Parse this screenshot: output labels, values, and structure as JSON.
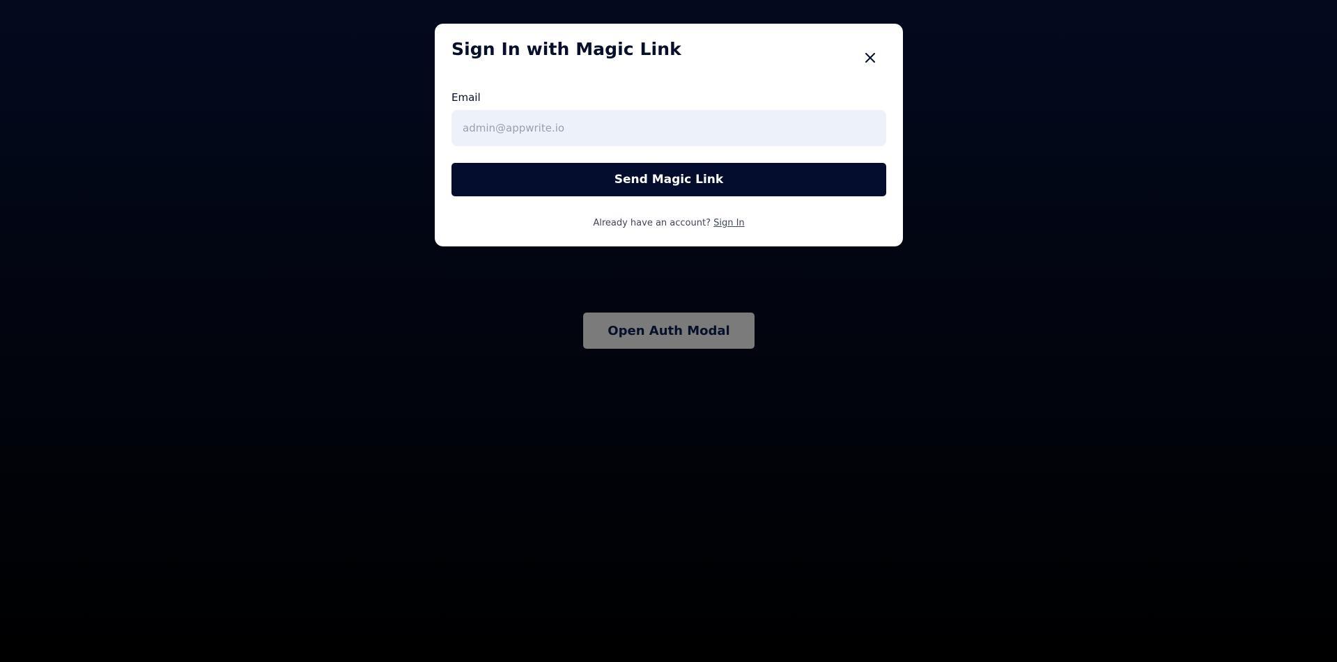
{
  "page": {
    "open_modal_label": "Open Auth Modal"
  },
  "modal": {
    "title": "Sign In with Magic Link",
    "close_icon": "close-icon",
    "email": {
      "label": "Email",
      "placeholder": "admin@appwrite.io",
      "value": ""
    },
    "send_label": "Send Magic Link",
    "footer": {
      "prompt": "Already have an account?",
      "link_label": "Sign In"
    }
  },
  "colors": {
    "background_top": "#030a1f",
    "background_bottom": "#000000",
    "modal_bg": "#ffffff",
    "primary_button": "#050d2e",
    "input_bg": "#edf2fa",
    "open_button_bg": "#7b7b7b"
  }
}
